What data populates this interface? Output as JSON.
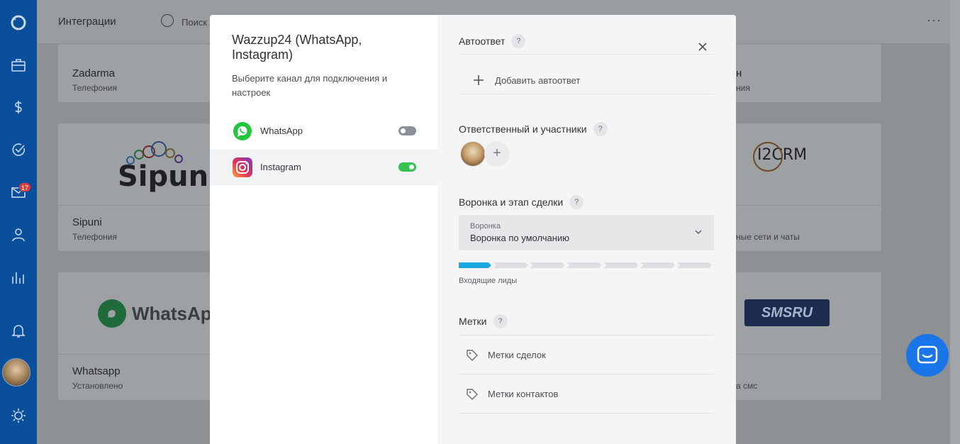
{
  "sidebar": {
    "icons": [
      "logo-icon",
      "briefcase-icon",
      "dollar-icon",
      "check-icon",
      "mail-icon",
      "user-icon",
      "chart-icon",
      "bell-icon",
      "settings-icon"
    ],
    "mail_badge": "17"
  },
  "topbar": {
    "title": "Интеграции",
    "search_placeholder": "Поиск"
  },
  "background_cards": {
    "zadarma": {
      "name": "Zadarma",
      "category": "Телефония"
    },
    "right_top": {
      "name": "н",
      "category": "ния"
    },
    "sipuni": {
      "name": "Sipuni",
      "category": "Телефония",
      "logo_text": "Sipuni"
    },
    "i2crm": {
      "logo_text": "I2CRM",
      "category": "ные сети и чаты"
    },
    "whatsapp": {
      "name": "Whatsapp",
      "category": "Установлено",
      "logo_text": "WhatsApp"
    },
    "smsru": {
      "logo_text": "SMSRU",
      "category": "а смс"
    }
  },
  "modal": {
    "title": "Wazzup24 (WhatsApp, Instagram)",
    "description": "Выберите канал для подключения и настроек",
    "channels": [
      {
        "label": "WhatsApp",
        "enabled": false,
        "active": false
      },
      {
        "label": "Instagram",
        "enabled": true,
        "active": true
      }
    ],
    "autoreply": {
      "title": "Автоответ",
      "help": "?",
      "add_label": "Добавить автоответ"
    },
    "responsible": {
      "title": "Ответственный и участники",
      "help": "?",
      "add_symbol": "+"
    },
    "funnel": {
      "title": "Воронка и этап сделки",
      "help": "?",
      "select_label": "Воронка",
      "select_value": "Воронка по умолчанию",
      "stage_count": 7,
      "active_stage": 1,
      "stage_label": "Входящие лиды"
    },
    "tags": {
      "title": "Метки",
      "help": "?",
      "items": [
        "Метки сделок",
        "Метки контактов"
      ]
    }
  },
  "colors": {
    "sidebar": "#0a4f9c",
    "toggle_on": "#33c24d",
    "toggle_off": "#8b9196",
    "stage_active": "#1ba9e1",
    "chat_fab": "#1a76e8"
  }
}
